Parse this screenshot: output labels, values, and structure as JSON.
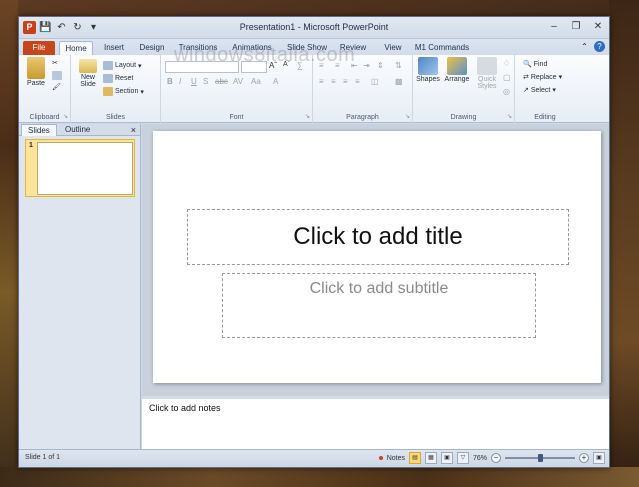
{
  "window": {
    "title": "Presentation1 - Microsoft PowerPoint",
    "watermark": "windows8italia.com"
  },
  "quick_access": {
    "app_icon": "P",
    "icons": [
      "save-icon",
      "undo-icon",
      "redo-icon",
      "customize-icon"
    ]
  },
  "tabs": [
    {
      "label": "File"
    },
    {
      "label": "Home"
    },
    {
      "label": "Insert"
    },
    {
      "label": "Design"
    },
    {
      "label": "Transitions"
    },
    {
      "label": "Animations"
    },
    {
      "label": "Slide Show"
    },
    {
      "label": "Review"
    },
    {
      "label": "View"
    },
    {
      "label": "M1 Commands"
    }
  ],
  "ribbon": {
    "clipboard": {
      "label": "Clipboard",
      "paste": "Paste"
    },
    "slides": {
      "label": "Slides",
      "new_slide": "New",
      "new_slide2": "Slide",
      "layout": "Layout",
      "reset": "Reset",
      "section": "Section"
    },
    "font": {
      "label": "Font"
    },
    "paragraph": {
      "label": "Paragraph"
    },
    "drawing": {
      "label": "Drawing",
      "shapes": "Shapes",
      "arrange": "Arrange",
      "quick_styles": "Quick",
      "quick_styles2": "Styles"
    },
    "editing": {
      "label": "Editing",
      "find": "Find",
      "replace": "Replace",
      "select": "Select"
    }
  },
  "panel": {
    "tab_slides": "Slides",
    "tab_outline": "Outline",
    "close": "×",
    "slide_number": "1"
  },
  "slide": {
    "title_placeholder": "Click to add title",
    "subtitle_placeholder": "Click to add subtitle"
  },
  "notes": {
    "placeholder": "Click to add notes"
  },
  "status": {
    "slide_info": "Slide 1 of 1",
    "notes_label": "Notes",
    "zoom": "76%"
  }
}
